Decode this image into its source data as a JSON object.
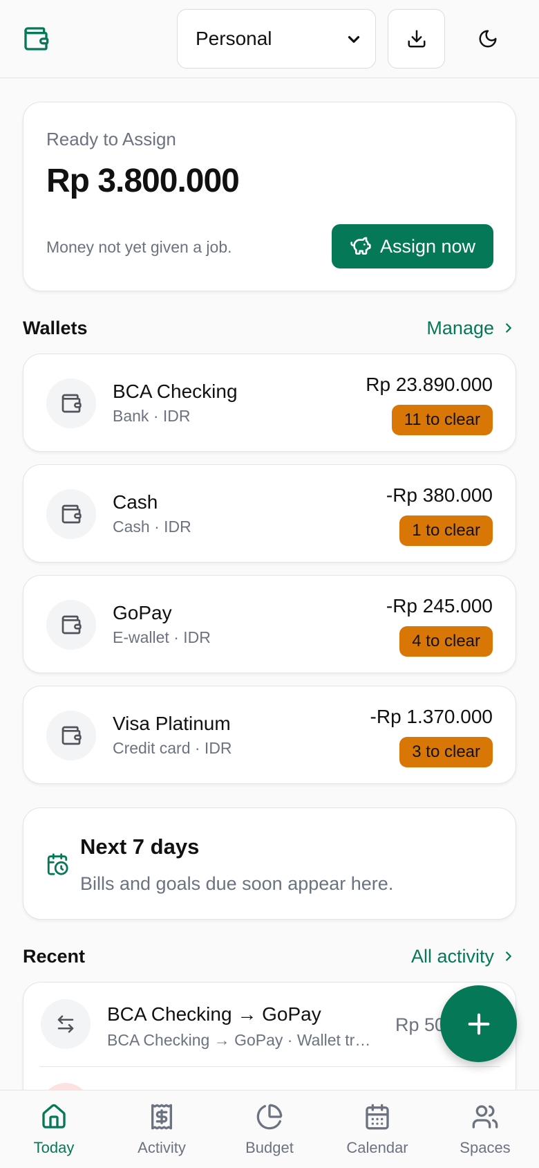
{
  "header": {
    "space": "Personal",
    "logo_icon": "wallet-icon",
    "download_icon": "download-icon",
    "theme_icon": "moon-icon"
  },
  "assign": {
    "label": "Ready to Assign",
    "amount": "Rp 3.800.000",
    "note": "Money not yet given a job.",
    "button": "Assign now",
    "button_icon": "piggy-bank-icon"
  },
  "wallets": {
    "title": "Wallets",
    "link": "Manage",
    "items": [
      {
        "name": "BCA Checking",
        "sub": "Bank · IDR",
        "amount": "Rp 23.890.000",
        "badge": "11 to clear"
      },
      {
        "name": "Cash",
        "sub": "Cash · IDR",
        "amount": "-Rp 380.000",
        "badge": "1 to clear"
      },
      {
        "name": "GoPay",
        "sub": "E-wallet · IDR",
        "amount": "-Rp 245.000",
        "badge": "4 to clear"
      },
      {
        "name": "Visa Platinum",
        "sub": "Credit card · IDR",
        "amount": "-Rp 1.370.000",
        "badge": "3 to clear"
      }
    ]
  },
  "next": {
    "title": "Next 7 days",
    "sub": "Bills and goals due soon appear here."
  },
  "recent": {
    "title": "Recent",
    "link": "All activity",
    "items": [
      {
        "title": "BCA Checking → GoPay",
        "sub": "BCA Checking → GoPay · Wallet transfer",
        "amount": "Rp 50"
      }
    ]
  },
  "nav": [
    {
      "label": "Today",
      "icon": "home-icon",
      "active": true
    },
    {
      "label": "Activity",
      "icon": "receipt-icon",
      "active": false
    },
    {
      "label": "Budget",
      "icon": "pie-chart-icon",
      "active": false
    },
    {
      "label": "Calendar",
      "icon": "calendar-icon",
      "active": false
    },
    {
      "label": "Spaces",
      "icon": "users-icon",
      "active": false
    }
  ],
  "colors": {
    "accent": "#047857",
    "badge": "#d97706",
    "muted": "#6b7280"
  }
}
